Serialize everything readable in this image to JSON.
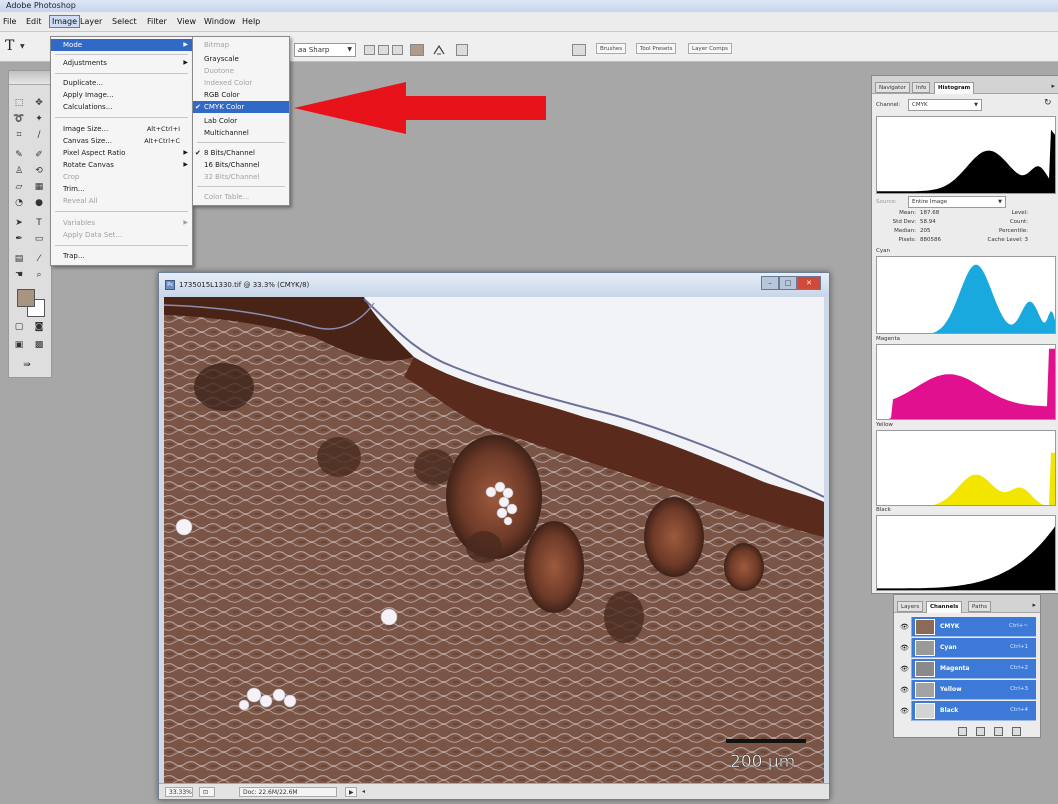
{
  "app": {
    "title": "Adobe Photoshop"
  },
  "menubar": {
    "items": [
      "File",
      "Edit",
      "Image",
      "Layer",
      "Select",
      "Filter",
      "View",
      "Window",
      "Help"
    ]
  },
  "options_bar": {
    "antialias": "Sharp",
    "dock_tabs": [
      "Brushes",
      "Tool Presets",
      "Layer Comps"
    ]
  },
  "image_menu": {
    "mode": "Mode",
    "adjustments": "Adjustments",
    "duplicate": "Duplicate...",
    "apply_image": "Apply Image...",
    "calculations": "Calculations...",
    "image_size": "Image Size...",
    "image_size_sc": "Alt+Ctrl+I",
    "canvas_size": "Canvas Size...",
    "canvas_size_sc": "Alt+Ctrl+C",
    "pixel_aspect": "Pixel Aspect Ratio",
    "rotate_canvas": "Rotate Canvas",
    "crop": "Crop",
    "trim": "Trim...",
    "reveal_all": "Reveal All",
    "variables": "Variables",
    "apply_data_set": "Apply Data Set...",
    "trap": "Trap..."
  },
  "mode_menu": {
    "bitmap": "Bitmap",
    "grayscale": "Grayscale",
    "duotone": "Duotone",
    "indexed": "Indexed Color",
    "rgb": "RGB Color",
    "cmyk": "CMYK Color",
    "lab": "Lab Color",
    "multichannel": "Multichannel",
    "bits8": "8 Bits/Channel",
    "bits16": "16 Bits/Channel",
    "bits32": "32 Bits/Channel",
    "color_table": "Color Table..."
  },
  "document": {
    "title": "1735015L1330.tif @ 33.3% (CMYK/8)",
    "zoom": "33.33%",
    "doc_size": "Doc: 22.6M/22.6M",
    "scale_bar": "200 µm"
  },
  "histogram_panel": {
    "tabs": [
      "Navigator",
      "Info",
      "Histogram"
    ],
    "channel_label": "Channel:",
    "channel_value": "CMYK",
    "source_label": "Source:",
    "source_value": "Entire Image",
    "stats_left": [
      {
        "label": "Mean:",
        "value": "187.68"
      },
      {
        "label": "Std Dev:",
        "value": "58.94"
      },
      {
        "label": "Median:",
        "value": "205"
      },
      {
        "label": "Pixels:",
        "value": "880586"
      }
    ],
    "stats_right": [
      "Level:",
      "Count:",
      "Percentile:",
      "Cache Level: 3"
    ],
    "channels": [
      "Cyan",
      "Magenta",
      "Yellow",
      "Black"
    ]
  },
  "channels_panel": {
    "tabs": [
      "Layers",
      "Channels",
      "Paths"
    ],
    "rows": [
      {
        "name": "CMYK",
        "shortcut": "Ctrl+~"
      },
      {
        "name": "Cyan",
        "shortcut": "Ctrl+1"
      },
      {
        "name": "Magenta",
        "shortcut": "Ctrl+2"
      },
      {
        "name": "Yellow",
        "shortcut": "Ctrl+3"
      },
      {
        "name": "Black",
        "shortcut": "Ctrl+4"
      }
    ]
  },
  "colors": {
    "cyan": "#1aa9df",
    "magenta": "#e0108f",
    "yellow": "#f2e600",
    "black": "#000000",
    "highlight": "#3169c6",
    "arrow": "#e8131a"
  }
}
